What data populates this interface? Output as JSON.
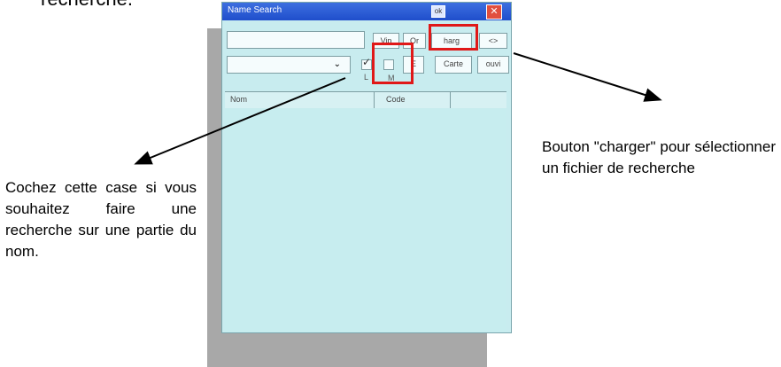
{
  "heading": "recherche.",
  "window": {
    "title": "Name Search",
    "ok_label": "ok",
    "close_label": "✕"
  },
  "controls": {
    "search_value": "",
    "btn_vip": "Vip",
    "btn_other": "Or",
    "btn_charger": "harg",
    "btn_arrows": "<>",
    "combo_value": "",
    "checkbox_l_label": "L",
    "checkbox_m_label": "M",
    "btn_e": "E",
    "btn_carte": "Carte",
    "btn_ouvrir": "ouvi"
  },
  "list": {
    "columns": [
      "Nom",
      "Code"
    ]
  },
  "annotations": {
    "left": "Cochez cette case si vous souhaitez faire une recherche sur une partie du nom.",
    "right": "Bouton \"charger\" pour sélectionner un fichier de recherche"
  },
  "colors": {
    "highlight": "#e01818",
    "device_bg": "#c8ecef",
    "titlebar": "#1f4ecb"
  }
}
